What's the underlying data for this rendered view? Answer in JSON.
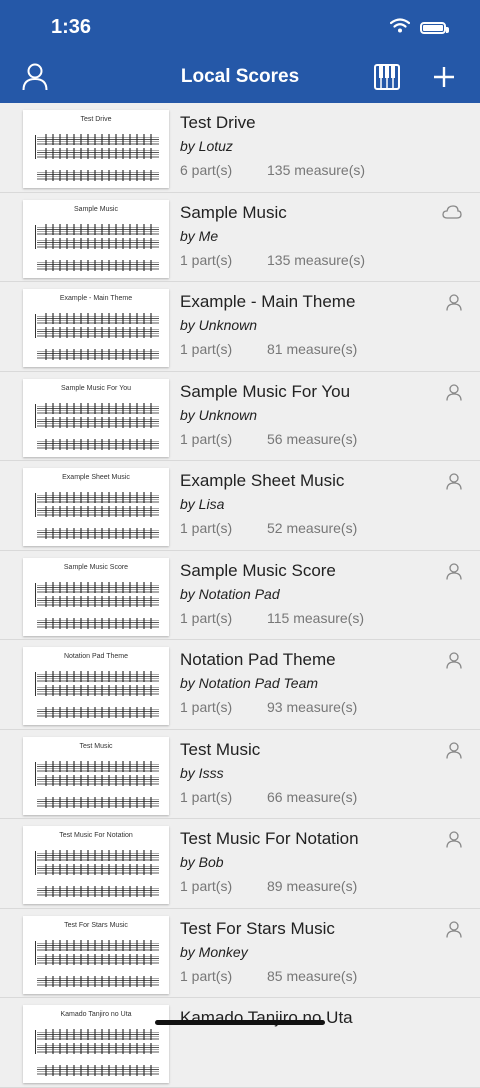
{
  "status_bar": {
    "time": "1:36"
  },
  "nav": {
    "title": "Local Scores",
    "icons": [
      "person-icon",
      "piano-icon",
      "plus-icon"
    ]
  },
  "scores": [
    {
      "thumb_title": "Test Drive",
      "title": "Test Drive",
      "author": "by Lotuz",
      "parts": "6 part(s)",
      "measures": "135 measure(s)",
      "status_icon": "none"
    },
    {
      "thumb_title": "Sample Music",
      "title": "Sample Music",
      "author": "by Me",
      "parts": "1 part(s)",
      "measures": "135 measure(s)",
      "status_icon": "cloud-icon"
    },
    {
      "thumb_title": "Example - Main Theme",
      "title": "Example - Main Theme",
      "author": "by Unknown",
      "parts": "1 part(s)",
      "measures": "81 measure(s)",
      "status_icon": "person-icon"
    },
    {
      "thumb_title": "Sample Music For You",
      "title": "Sample Music For You",
      "author": "by Unknown",
      "parts": "1 part(s)",
      "measures": "56 measure(s)",
      "status_icon": "person-icon"
    },
    {
      "thumb_title": "Example Sheet Music",
      "title": "Example Sheet Music",
      "author": "by Lisa",
      "parts": "1 part(s)",
      "measures": "52 measure(s)",
      "status_icon": "person-icon"
    },
    {
      "thumb_title": "Sample Music Score",
      "title": "Sample Music Score",
      "author": "by Notation Pad",
      "parts": "1 part(s)",
      "measures": "115 measure(s)",
      "status_icon": "person-icon"
    },
    {
      "thumb_title": "Notation Pad Theme",
      "title": "Notation Pad Theme",
      "author": "by Notation Pad Team",
      "parts": "1 part(s)",
      "measures": "93 measure(s)",
      "status_icon": "person-icon"
    },
    {
      "thumb_title": "Test Music",
      "title": "Test Music",
      "author": "by Isss",
      "parts": "1 part(s)",
      "measures": "66 measure(s)",
      "status_icon": "person-icon"
    },
    {
      "thumb_title": "Test Music For Notation",
      "title": "Test Music For Notation",
      "author": "by Bob",
      "parts": "1 part(s)",
      "measures": "89 measure(s)",
      "status_icon": "person-icon"
    },
    {
      "thumb_title": "Test For Stars Music",
      "title": "Test For Stars Music",
      "author": "by Monkey",
      "parts": "1 part(s)",
      "measures": "85 measure(s)",
      "status_icon": "person-icon"
    },
    {
      "thumb_title": "Kamado Tanjiro no Uta",
      "title": "Kamado Tanjiro no Uta",
      "author": "",
      "parts": "",
      "measures": "",
      "status_icon": "none"
    }
  ],
  "colors": {
    "nav_bg": "#2558a8",
    "list_bg": "#efefef",
    "secondary_text": "#777777"
  }
}
